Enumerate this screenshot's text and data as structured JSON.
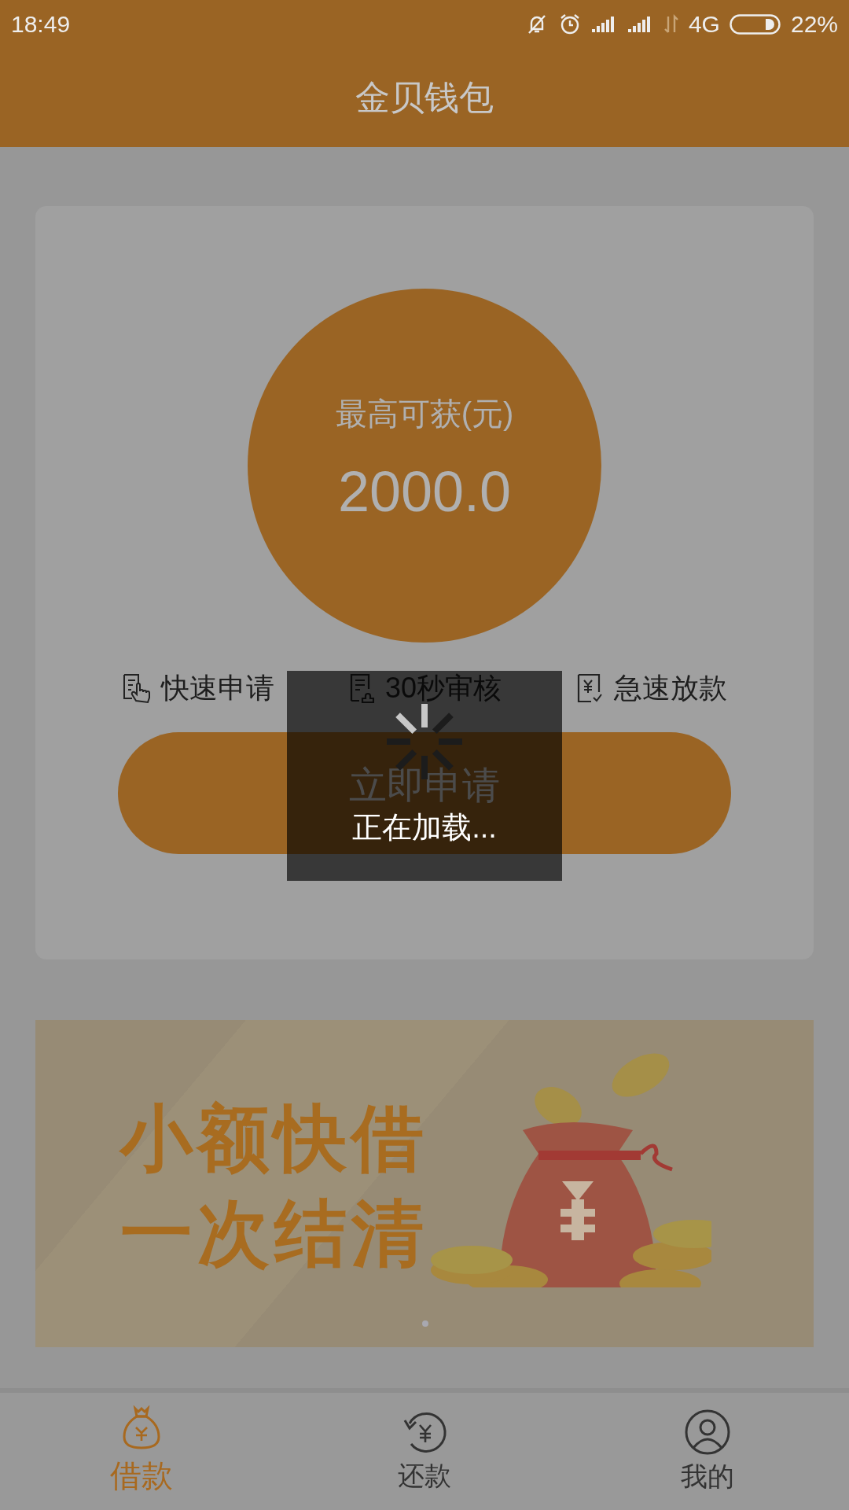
{
  "status_bar": {
    "time": "18:49",
    "network": "4G",
    "battery": "22%"
  },
  "header": {
    "title": "金贝钱包"
  },
  "quota": {
    "label": "最高可获(元)",
    "amount": "2000.0"
  },
  "features": [
    {
      "kind": "apply",
      "label": "快速申请"
    },
    {
      "kind": "review",
      "label": "30秒审核"
    },
    {
      "kind": "payout",
      "label": "急速放款"
    }
  ],
  "apply_button": {
    "label": "立即申请"
  },
  "banner": {
    "lines": [
      "小额快借",
      "一次结清"
    ]
  },
  "loading": {
    "text": "正在加载..."
  },
  "tabs": [
    {
      "kind": "loan",
      "label": "借款",
      "selected": true
    },
    {
      "kind": "repay",
      "label": "还款",
      "selected": false
    },
    {
      "kind": "profile",
      "label": "我的",
      "selected": false
    }
  ]
}
